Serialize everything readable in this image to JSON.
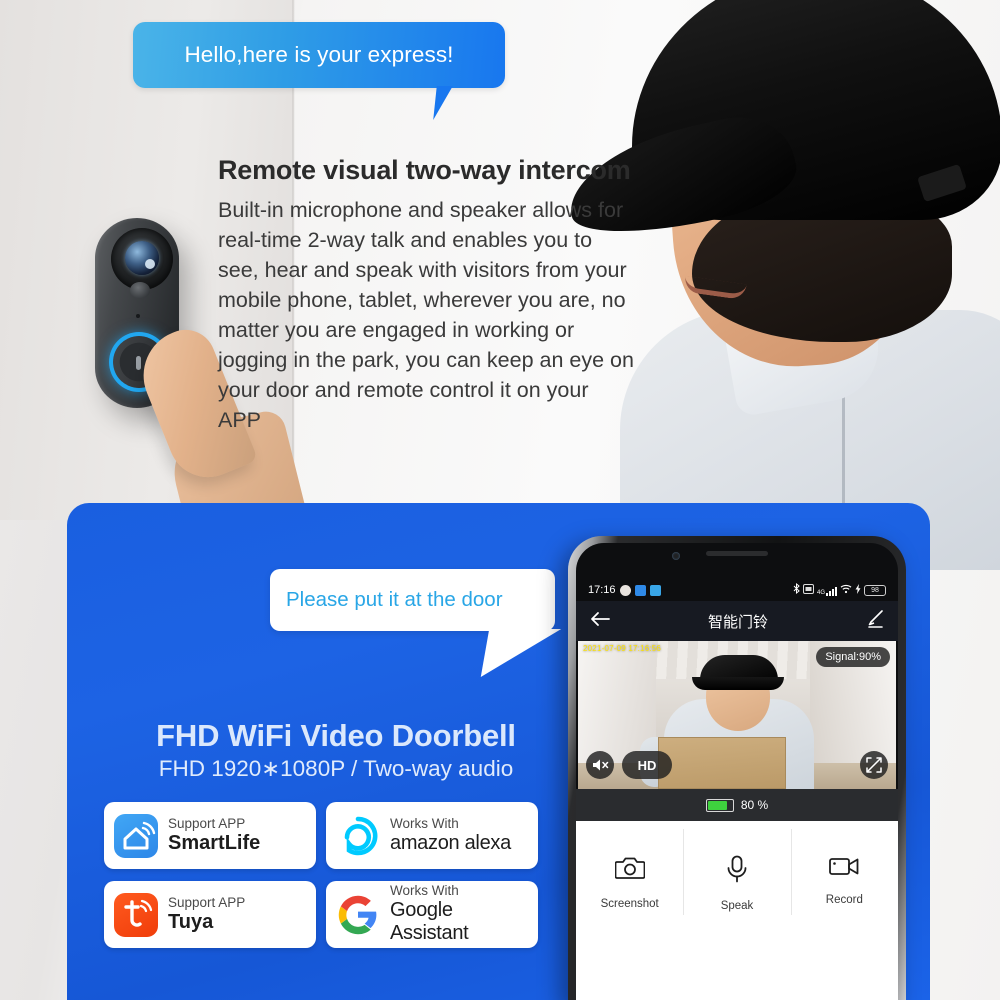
{
  "scene": {
    "bubble_top": {
      "text": "Hello,here is your express!",
      "gradient_from": "#4ab4e8",
      "gradient_to": "#1877ef"
    },
    "feature": {
      "title": "Remote visual two-way intercom",
      "body": "Built-in microphone and speaker allows for real-time 2-way talk and enables you to see, hear and speak with visitors from your mobile phone, tablet, wherever you are, no matter you are engaged in working or jogging in the park, you can keep an eye on your door and remote control it on your APP"
    },
    "doorbell_alt": "video-doorbell-device",
    "person_alt": "delivery-man-with-black-cap"
  },
  "promo": {
    "panel_color": "#1a5fe0",
    "bubble": {
      "text": "Please put it at the door",
      "text_color": "#29a6e6"
    },
    "headline": "FHD WiFi Video Doorbell",
    "subline": "FHD 1920∗1080P / Two-way audio",
    "badges": [
      {
        "sub": "Support APP",
        "name": "SmartLife",
        "icon": "smartlife-icon",
        "color": "#2d87e8"
      },
      {
        "sub": "Works With",
        "name": "amazon alexa",
        "icon": "alexa-icon",
        "color": "#00caff"
      },
      {
        "sub": "Support APP",
        "name": "Tuya",
        "icon": "tuya-icon",
        "color": "#ff5a1f"
      },
      {
        "sub": "Works With",
        "name": "Google Assistant",
        "icon": "google-icon",
        "color": "#4285f4"
      }
    ]
  },
  "phone": {
    "status": {
      "time": "17:16",
      "network": "4G",
      "battery_level": "98",
      "icons": [
        "bluetooth-icon",
        "sim-icon",
        "signal-icon",
        "wifi-icon",
        "charging-icon",
        "battery-icon"
      ]
    },
    "appbar": {
      "back": "back-arrow-icon",
      "title": "智能门铃",
      "edit": "edit-pencil-icon"
    },
    "video": {
      "timestamp": "2021-07-09 17:16:56",
      "signal": "Signal:90%",
      "quality": "HD",
      "mute": "speaker-mute-icon",
      "fullscreen": "fullscreen-icon"
    },
    "battery_row": {
      "percent": "80 %",
      "fill": 80,
      "color": "#3ed13e"
    },
    "actions": [
      {
        "label": "Screenshot",
        "icon": "camera-icon"
      },
      {
        "label": "Speak",
        "icon": "microphone-icon"
      },
      {
        "label": "Record",
        "icon": "video-camera-icon"
      }
    ]
  }
}
